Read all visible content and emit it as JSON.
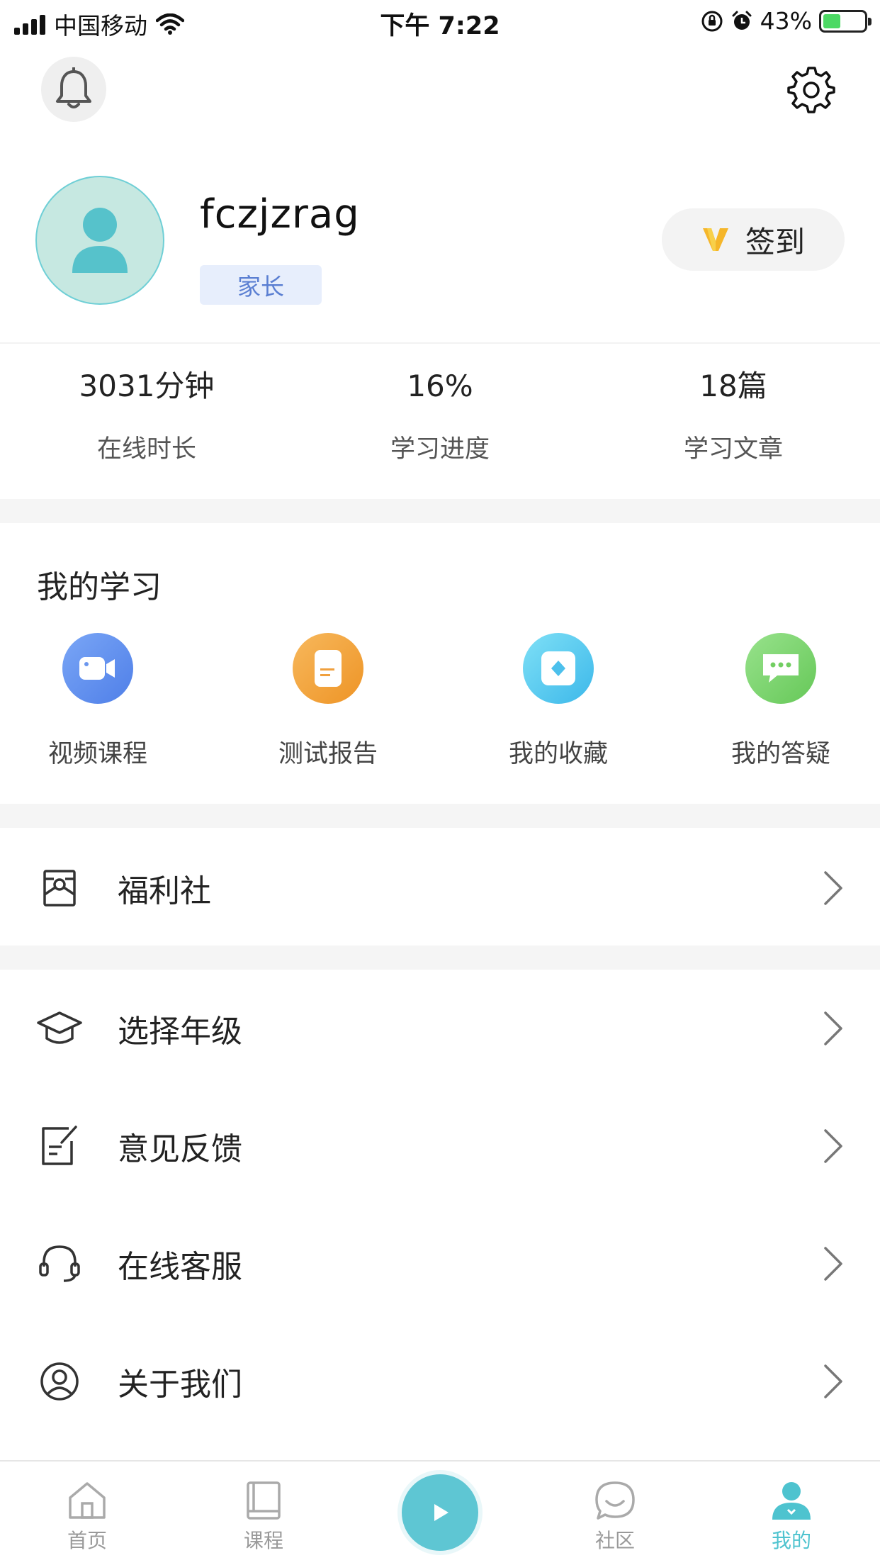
{
  "status_bar": {
    "carrier": "中国移动",
    "time": "下午 7:22",
    "battery_percent": "43%",
    "battery_level": 0.43,
    "icons": [
      "signal-icon",
      "wifi-icon",
      "rotation-lock-icon",
      "alarm-icon",
      "battery-charging-icon"
    ]
  },
  "header": {
    "notification_icon": "bell-icon",
    "settings_icon": "gear-icon"
  },
  "profile": {
    "username": "fczjzrag",
    "role": "家长",
    "checkin_label": "签到",
    "checkin_icon": "v-badge-icon"
  },
  "stats": [
    {
      "value": "3031分钟",
      "label": "在线时长"
    },
    {
      "value": "16%",
      "label": "学习进度"
    },
    {
      "value": "18篇",
      "label": "学习文章"
    }
  ],
  "my_learning": {
    "title": "我的学习",
    "items": [
      {
        "label": "视频课程",
        "icon": "video-camera-icon",
        "color": "#5f8ef0"
      },
      {
        "label": "测试报告",
        "icon": "report-document-icon",
        "color": "#f0a03e"
      },
      {
        "label": "我的收藏",
        "icon": "favorites-diamond-icon",
        "color": "#52c6ee"
      },
      {
        "label": "我的答疑",
        "icon": "chat-bubble-icon",
        "color": "#7fd56f"
      }
    ]
  },
  "menu": {
    "welfare": {
      "label": "福利社",
      "icon": "gift-box-icon"
    },
    "items": [
      {
        "label": "选择年级",
        "icon": "graduation-cap-icon"
      },
      {
        "label": "意见反馈",
        "icon": "feedback-edit-icon"
      },
      {
        "label": "在线客服",
        "icon": "headset-icon"
      },
      {
        "label": "关于我们",
        "icon": "user-circle-icon"
      }
    ]
  },
  "tabbar": {
    "tabs": [
      {
        "label": "首页",
        "icon": "home-icon",
        "active": false
      },
      {
        "label": "课程",
        "icon": "book-icon",
        "active": false
      },
      {
        "label": "社区",
        "icon": "community-chat-icon",
        "active": false
      },
      {
        "label": "我的",
        "icon": "profile-person-icon",
        "active": true
      }
    ],
    "center_icon": "play-icon",
    "accent_color": "#4ec3cf"
  }
}
